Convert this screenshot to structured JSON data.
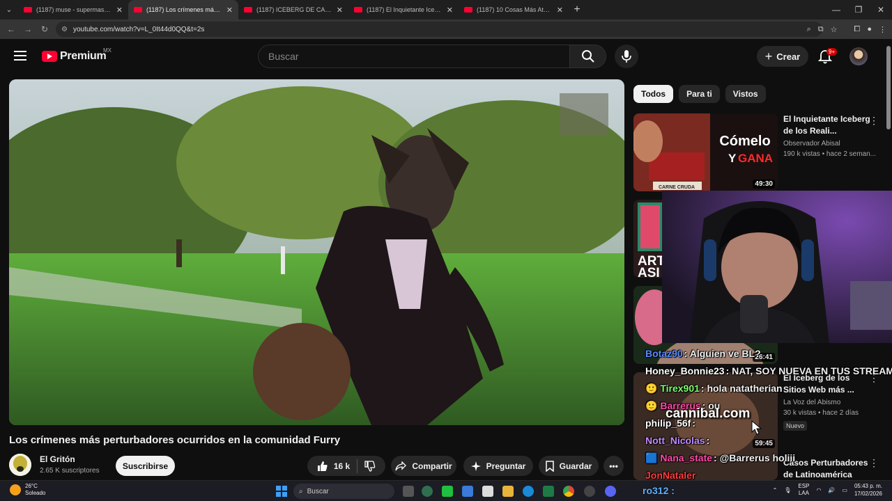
{
  "browser": {
    "tabs": [
      {
        "title": "(1187) muse - supermassive bla",
        "active": false
      },
      {
        "title": "(1187) Los crímenes más pertur",
        "active": true
      },
      {
        "title": "(1187) ICEBERG DE CASOS OC",
        "active": false
      },
      {
        "title": "(1187) El Inquietante Iceberg de",
        "active": false
      },
      {
        "title": "(1187) 10 Cosas Más Aterrador",
        "active": false
      }
    ],
    "url": "youtube.com/watch?v=L_0It44d0QQ&t=2s"
  },
  "header": {
    "logo_text": "Premium",
    "region": "MX",
    "search_placeholder": "Buscar",
    "create_label": "Crear",
    "notifications_badge": "9+"
  },
  "video": {
    "title": "Los crímenes más perturbadores ocurridos en la comunidad Furry",
    "channel": "El Gritón",
    "subscribers": "2.65 K suscriptores",
    "subscribe_label": "Suscribirse",
    "likes": "16 k",
    "share_label": "Compartir",
    "ask_label": "Preguntar",
    "save_label": "Guardar"
  },
  "chips": [
    "Todos",
    "Para ti",
    "Vistos"
  ],
  "recommendations": [
    {
      "title": "El Inquietante Iceberg de los Reali...",
      "channel": "Observador Abisal",
      "meta": "190 k vistas • hace 2 seman...",
      "duration": "49:30",
      "thumb_text_1": "Cómelo",
      "thumb_text_2": "GANA",
      "thumb_text_y": "Y",
      "thumb_caption": "CARNE CRUDA"
    },
    {
      "title": "",
      "channel": "",
      "meta": "",
      "duration": "26:41",
      "thumb_text_1": "ART",
      "thumb_text_2": "ASI"
    },
    {
      "title": "El Iceberg de los Sitios Web más ...",
      "channel": "La Voz del Abismo",
      "meta": "30 k vistas • hace 2 días",
      "duration": "59:45",
      "badge": "Nuevo"
    },
    {
      "title": "Casos Perturbadores de Latinoamérica",
      "channel": "",
      "meta": "",
      "duration": ""
    }
  ],
  "chat": [
    {
      "user": "Botaz90",
      "msg": ": Alguien ve BL?",
      "color": "#5a8cff"
    },
    {
      "user": "Honey_Bonnie23",
      "msg": ": NAT, SOY NUEVA EN TUS STREAMS",
      "color": "#ffffff"
    },
    {
      "user": "Tirex901",
      "msg": ": hola natatherian",
      "color": "#7dff6e"
    },
    {
      "user": "Barrerus",
      "msg": ": ou",
      "color": "#ff4aa8"
    },
    {
      "user": "philip_56f",
      "msg": ":",
      "color": "#ffffff"
    },
    {
      "user": "Nott_Nicolas",
      "msg": ":",
      "color": "#c28bff"
    },
    {
      "user": "Nana_state",
      "msg": ": @Barrerus holiii",
      "color": "#ff4aa8"
    },
    {
      "user": "JonNataler",
      "msg": "",
      "color": "#ff3b3b"
    }
  ],
  "chat_overlay": {
    "cannibal": "cannibal.com",
    "bottom_user": "ro312 :"
  },
  "taskbar": {
    "temp": "26°C",
    "weather": "Soleado",
    "search": "Buscar",
    "lang1": "ESP",
    "lang2": "LAA",
    "time": "05:43 p. m.",
    "date": "17/02/2026"
  }
}
